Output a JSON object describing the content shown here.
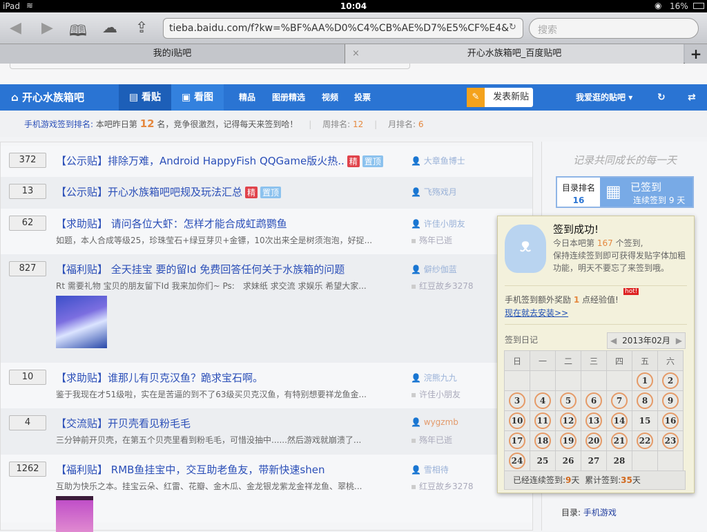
{
  "status": {
    "device": "iPad",
    "time": "10:04",
    "battery": "16%"
  },
  "browser": {
    "url": "tieba.baidu.com/f?kw=%BF%AA%D0%C4%CB%AE%D7%E5%CF%E4&",
    "search_placeholder": "搜索",
    "tabs": [
      {
        "label": "我的i贴吧"
      },
      {
        "label": "开心水族箱吧_百度贴吧"
      }
    ]
  },
  "nav": {
    "forum": "开心水族箱吧",
    "items": [
      "看贴",
      "看图",
      "精品",
      "图册精选",
      "视频",
      "投票"
    ],
    "post_button": "发表新贴",
    "favorites": "我爱逛的贴吧"
  },
  "rank": {
    "label": "手机游戏签到排名:",
    "text1": "本吧昨日第",
    "rank": "12",
    "text2": "名，竞争很激烈，记得每天来签到哈！",
    "week_label": "周排名:",
    "week": "12",
    "month_label": "月排名:",
    "month": "6"
  },
  "posts": [
    {
      "count": "372",
      "title": "【公示贴】排除万难，Android HappyFish QQGame版火热..",
      "tags": [
        "精",
        "置顶"
      ],
      "author": "大章鱼博士",
      "abstract": "",
      "last": ""
    },
    {
      "count": "13",
      "title": "【公示贴】开心水族箱吧吧规及玩法汇总",
      "tags": [
        "精",
        "置顶"
      ],
      "author": "飞殇戏月",
      "abstract": "",
      "last": ""
    },
    {
      "count": "62",
      "title": "【求助贴】 请问各位大虾：怎样才能合成虹鹉鹦鱼",
      "tags": [],
      "author": "许佳小朋友",
      "abstract": "如题，本人合成等级25，珍珠莹石+绿豆芽贝+金镖，10次出来全是树须泡泡，好捉...",
      "last": "殇年已逝"
    },
    {
      "count": "827",
      "title": "【福利贴】 全天挂宝 要的留Id 免费回答任何关于水族箱的问题",
      "tags": [],
      "author": "僻纱伽蓝",
      "abstract": "Rt 需要礼物 宝贝的朋友留下Id 我来加你们~ Ps:　求妹纸 求交流 求娱乐 希望大家...",
      "last": "红豆故乡3278"
    },
    {
      "count": "10",
      "title": "【求助贴】谁那儿有贝克汉鱼？跪求宝石啊。",
      "tags": [],
      "author": "浣熊九九",
      "abstract": "鉴于我现在才51级啦，实在是苦逼的到不了63级买贝克汉鱼，有特别想要祥龙鱼金...",
      "last": "许佳小朋友"
    },
    {
      "count": "4",
      "title": "【交流贴】开贝壳看见粉毛毛",
      "tags": [],
      "author": "wygzmb",
      "abstract": "三分钟前开贝壳，在第五个贝壳里看到粉毛毛，可惜没抽中......然后游戏就崩溃了...",
      "last": "殇年已逝"
    },
    {
      "count": "1262",
      "title": "【福利贴】 RMB鱼挂宝中，交互助老鱼友，带新快速shen",
      "tags": [],
      "author": "雪相待",
      "abstract": "互助为快乐之本。挂宝云朵、红雷、花瓣、金木瓜、金龙银龙紫龙金祥龙鱼、翠桃...",
      "last": "红豆故乡3278"
    }
  ],
  "sidebar": {
    "slogan": "记录共同成长的每一天",
    "dir_rank_label": "目录排名",
    "dir_rank": "16",
    "signed": "已签到",
    "streak": "连续签到 9 天",
    "dir_label": "目录:",
    "dir": "手机游戏"
  },
  "popup": {
    "title": "签到成功!",
    "line1a": "今日本吧第",
    "order": "167",
    "line1b": "个签到,",
    "line2": "保持连续签到即可获得发贴字体加粗功能，明天不要忘了来签到哦。",
    "bonus_a": "手机签到额外奖励",
    "bonus": "1",
    "bonus_b": "点经验值!",
    "hot": "hot!",
    "install": "现在就去安装>>",
    "diary": "签到日记",
    "month": "2013年02月",
    "weekdays": [
      "日",
      "一",
      "二",
      "三",
      "四",
      "五",
      "六"
    ],
    "first_weekday": 5,
    "days": 28,
    "signed_days": [
      1,
      2,
      3,
      4,
      5,
      6,
      7,
      8,
      9,
      10,
      11,
      12,
      13,
      14,
      16,
      17,
      18,
      19,
      20,
      21,
      22,
      23,
      24
    ],
    "streak_label": "已经连续签到:",
    "streak": "9",
    "total_label": "累计签到:",
    "total": "35",
    "unit": "天"
  },
  "colors": {
    "nav": "#2a74d3",
    "orange": "#e5883f",
    "link": "#2b4fb8"
  }
}
